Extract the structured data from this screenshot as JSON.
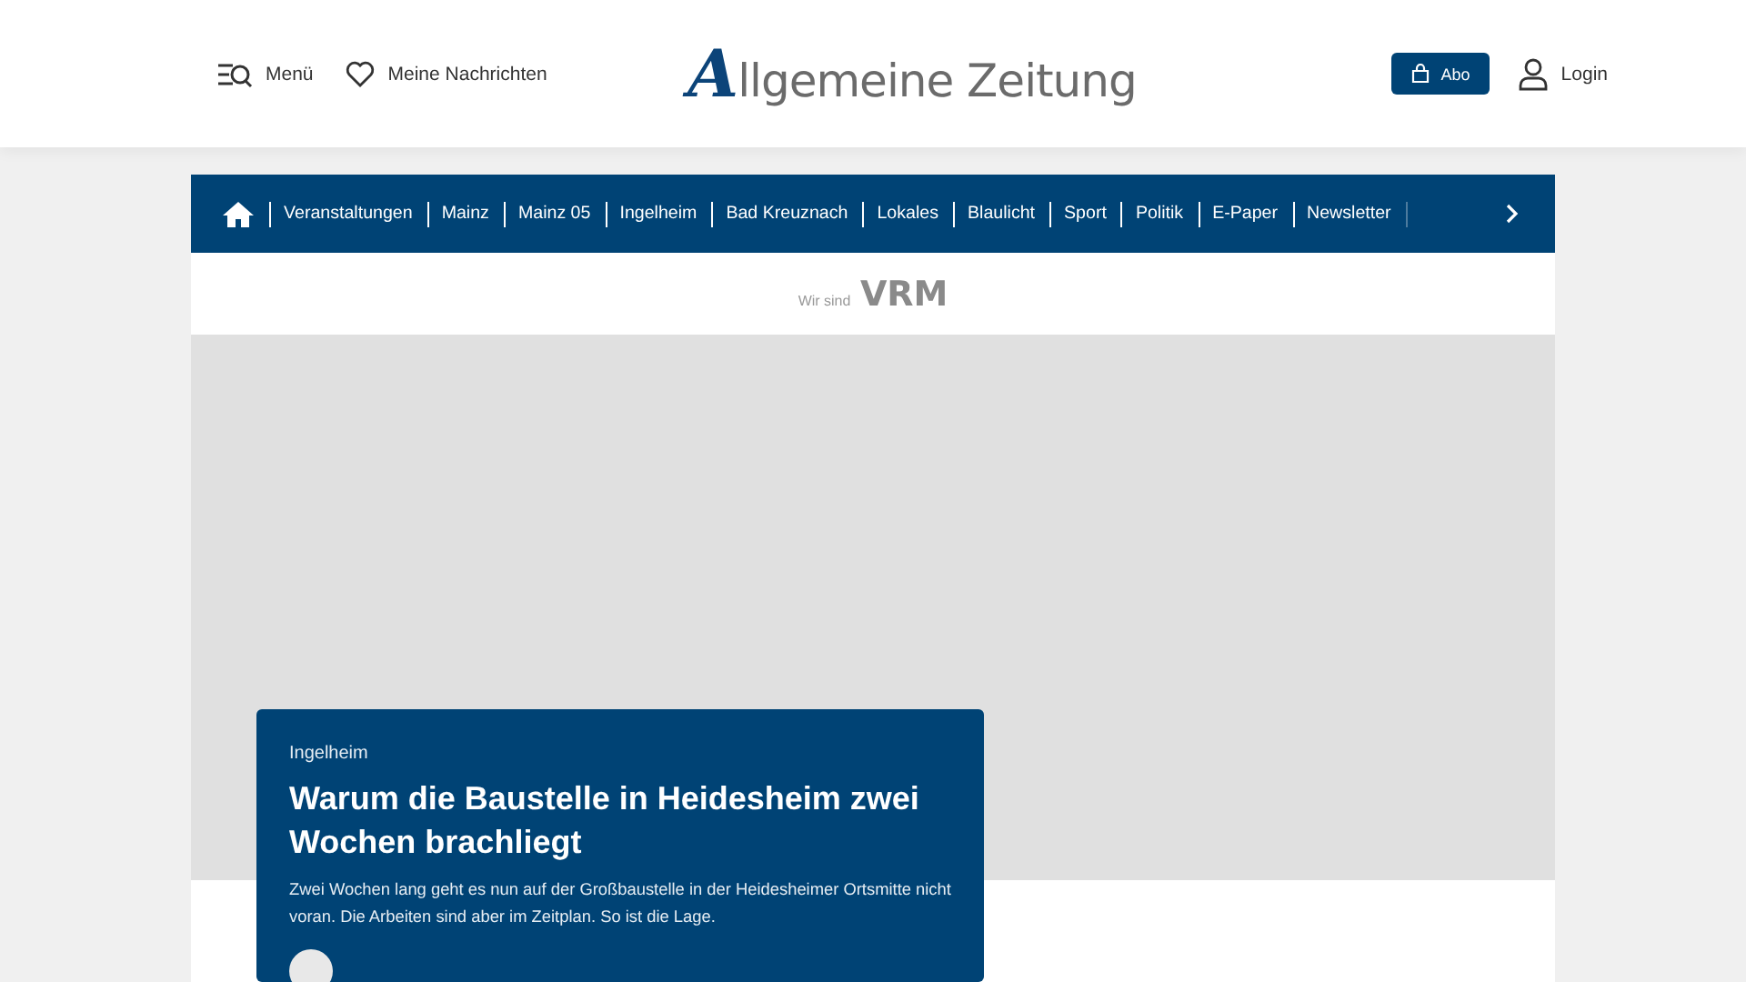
{
  "header": {
    "menu": "Menü",
    "saved": "Meine Nachrichten",
    "logo": "Allgemeine Zeitung",
    "subscribe": "Abo",
    "login": "Login"
  },
  "nav": {
    "items": [
      {
        "label": "Veranstaltungen"
      },
      {
        "label": "Mainz"
      },
      {
        "label": "Mainz 05"
      },
      {
        "label": "Ingelheim"
      },
      {
        "label": "Bad Kreuznach"
      },
      {
        "label": "Lokales"
      },
      {
        "label": "Blaulicht"
      },
      {
        "label": "Sport"
      },
      {
        "label": "Politik"
      },
      {
        "label": "E-Paper"
      },
      {
        "label": "Newsletter"
      }
    ]
  },
  "brand_strip": "Wir sind **VRM**",
  "teaser": {
    "category": "Ingelheim",
    "headline": "Warum die Baustelle in Heidesheim zwei Wochen brachliegt",
    "summary": "Zwei Wochen lang geht es nun auf der Großbaustelle in der Heidesheimer Ortsmitte nicht voran. Die Arbeiten sind aber im Zeitplan. So ist die Lage."
  }
}
